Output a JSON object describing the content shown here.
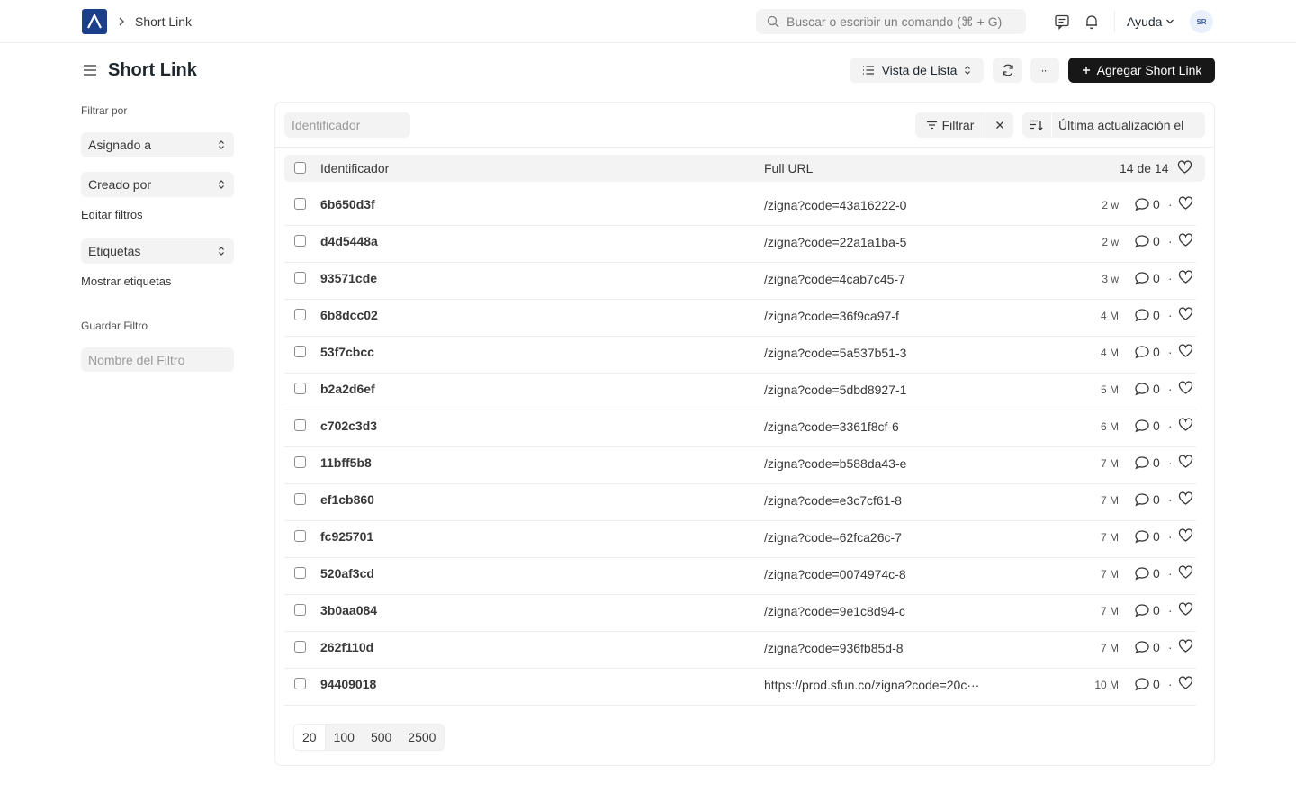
{
  "navbar": {
    "breadcrumb": "Short Link",
    "search_placeholder": "Buscar o escribir un comando (⌘ + G)",
    "help_label": "Ayuda",
    "avatar_initials": "SR"
  },
  "page": {
    "title": "Short Link",
    "view_label": "Vista de Lista",
    "more_label": "···",
    "add_label": "Agregar Short Link"
  },
  "sidebar": {
    "filter_by": "Filtrar por",
    "assigned_to": "Asignado a",
    "created_by": "Creado por",
    "edit_filters": "Editar filtros",
    "tags": "Etiquetas",
    "show_tags": "Mostrar etiquetas",
    "save_filter": "Guardar Filtro",
    "filter_name_placeholder": "Nombre del Filtro"
  },
  "list": {
    "id_placeholder": "Identificador",
    "filter_label": "Filtrar",
    "sort_label": "Última actualización el",
    "col_id": "Identificador",
    "col_url": "Full URL",
    "count": "14 de 14",
    "rows": [
      {
        "id": "6b650d3f",
        "url": "/zigna?code=43a16222-0",
        "time": "2 w",
        "comments": "0"
      },
      {
        "id": "d4d5448a",
        "url": "/zigna?code=22a1a1ba-5",
        "time": "2 w",
        "comments": "0"
      },
      {
        "id": "93571cde",
        "url": "/zigna?code=4cab7c45-7",
        "time": "3 w",
        "comments": "0"
      },
      {
        "id": "6b8dcc02",
        "url": "/zigna?code=36f9ca97-f",
        "time": "4 M",
        "comments": "0"
      },
      {
        "id": "53f7cbcc",
        "url": "/zigna?code=5a537b51-3",
        "time": "4 M",
        "comments": "0"
      },
      {
        "id": "b2a2d6ef",
        "url": "/zigna?code=5dbd8927-1",
        "time": "5 M",
        "comments": "0"
      },
      {
        "id": "c702c3d3",
        "url": "/zigna?code=3361f8cf-6",
        "time": "6 M",
        "comments": "0"
      },
      {
        "id": "11bff5b8",
        "url": "/zigna?code=b588da43-e",
        "time": "7 M",
        "comments": "0"
      },
      {
        "id": "ef1cb860",
        "url": "/zigna?code=e3c7cf61-8",
        "time": "7 M",
        "comments": "0"
      },
      {
        "id": "fc925701",
        "url": "/zigna?code=62fca26c-7",
        "time": "7 M",
        "comments": "0"
      },
      {
        "id": "520af3cd",
        "url": "/zigna?code=0074974c-8",
        "time": "7 M",
        "comments": "0"
      },
      {
        "id": "3b0aa084",
        "url": "/zigna?code=9e1c8d94-c",
        "time": "7 M",
        "comments": "0"
      },
      {
        "id": "262f110d",
        "url": "/zigna?code=936fb85d-8",
        "time": "7 M",
        "comments": "0"
      },
      {
        "id": "94409018",
        "url": "https://prod.sfun.co/zigna?code=20c···",
        "time": "10 M",
        "comments": "0"
      }
    ],
    "page_sizes": [
      "20",
      "100",
      "500",
      "2500"
    ]
  },
  "colors": {
    "logo": "#1c3f8c",
    "primary_button": "#171717",
    "control_bg": "#f3f3f3",
    "border": "#ededed"
  }
}
